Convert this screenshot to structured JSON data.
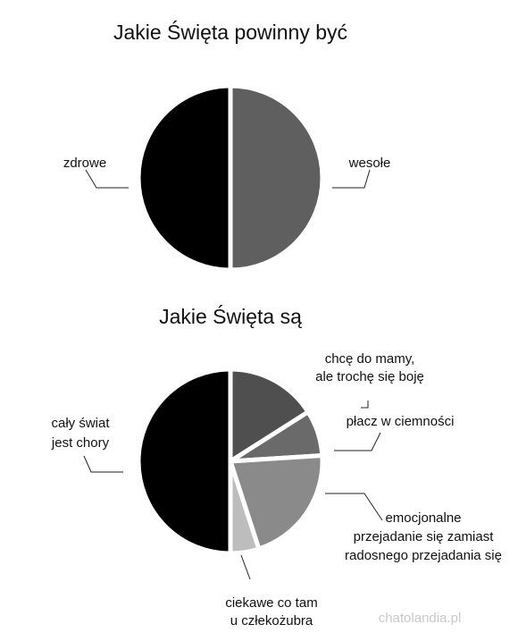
{
  "chart_data": [
    {
      "type": "pie",
      "title": "Jakie Święta powinny być",
      "slices": [
        {
          "label": "wesołe",
          "value": 50,
          "color": "#5f5f5f"
        },
        {
          "label": "zdrowe",
          "value": 50,
          "color": "#000000"
        }
      ]
    },
    {
      "type": "pie",
      "title": "Jakie Święta są",
      "slices": [
        {
          "label": "chcę do mamy, ale trochę się boję",
          "value": 16,
          "color": "#4f4f4f"
        },
        {
          "label": "płacz w ciemności",
          "value": 8,
          "color": "#6a6a6a"
        },
        {
          "label": "emocjonalne przejadanie się zamiast radosnego przejadania się",
          "value": 21,
          "color": "#8a8a8a"
        },
        {
          "label": "ciekawe co tam u człekożubra",
          "value": 5,
          "color": "#bdbdbd"
        },
        {
          "label": "cały świat jest chory",
          "value": 50,
          "color": "#000000"
        }
      ]
    }
  ],
  "texts": {
    "title1": "Jakie Święta powinny być",
    "title2": "Jakie Święta są",
    "p1_wesole": "wesołe",
    "p1_zdrowe": "zdrowe",
    "p2_chce_1": "chcę do mamy,",
    "p2_chce_2": "ale trochę się boję",
    "p2_placz": "płacz w ciemności",
    "p2_emocje_1": "emocjonalne",
    "p2_emocje_2": "przejadanie się zamiast",
    "p2_emocje_3": "radosnego przejadania się",
    "p2_ciekawe_1": "ciekawe co tam",
    "p2_ciekawe_2": "u człekożubra",
    "p2_caly_1": "cały świat",
    "p2_caly_2": "jest chory",
    "watermark": "chatolandia.pl"
  }
}
